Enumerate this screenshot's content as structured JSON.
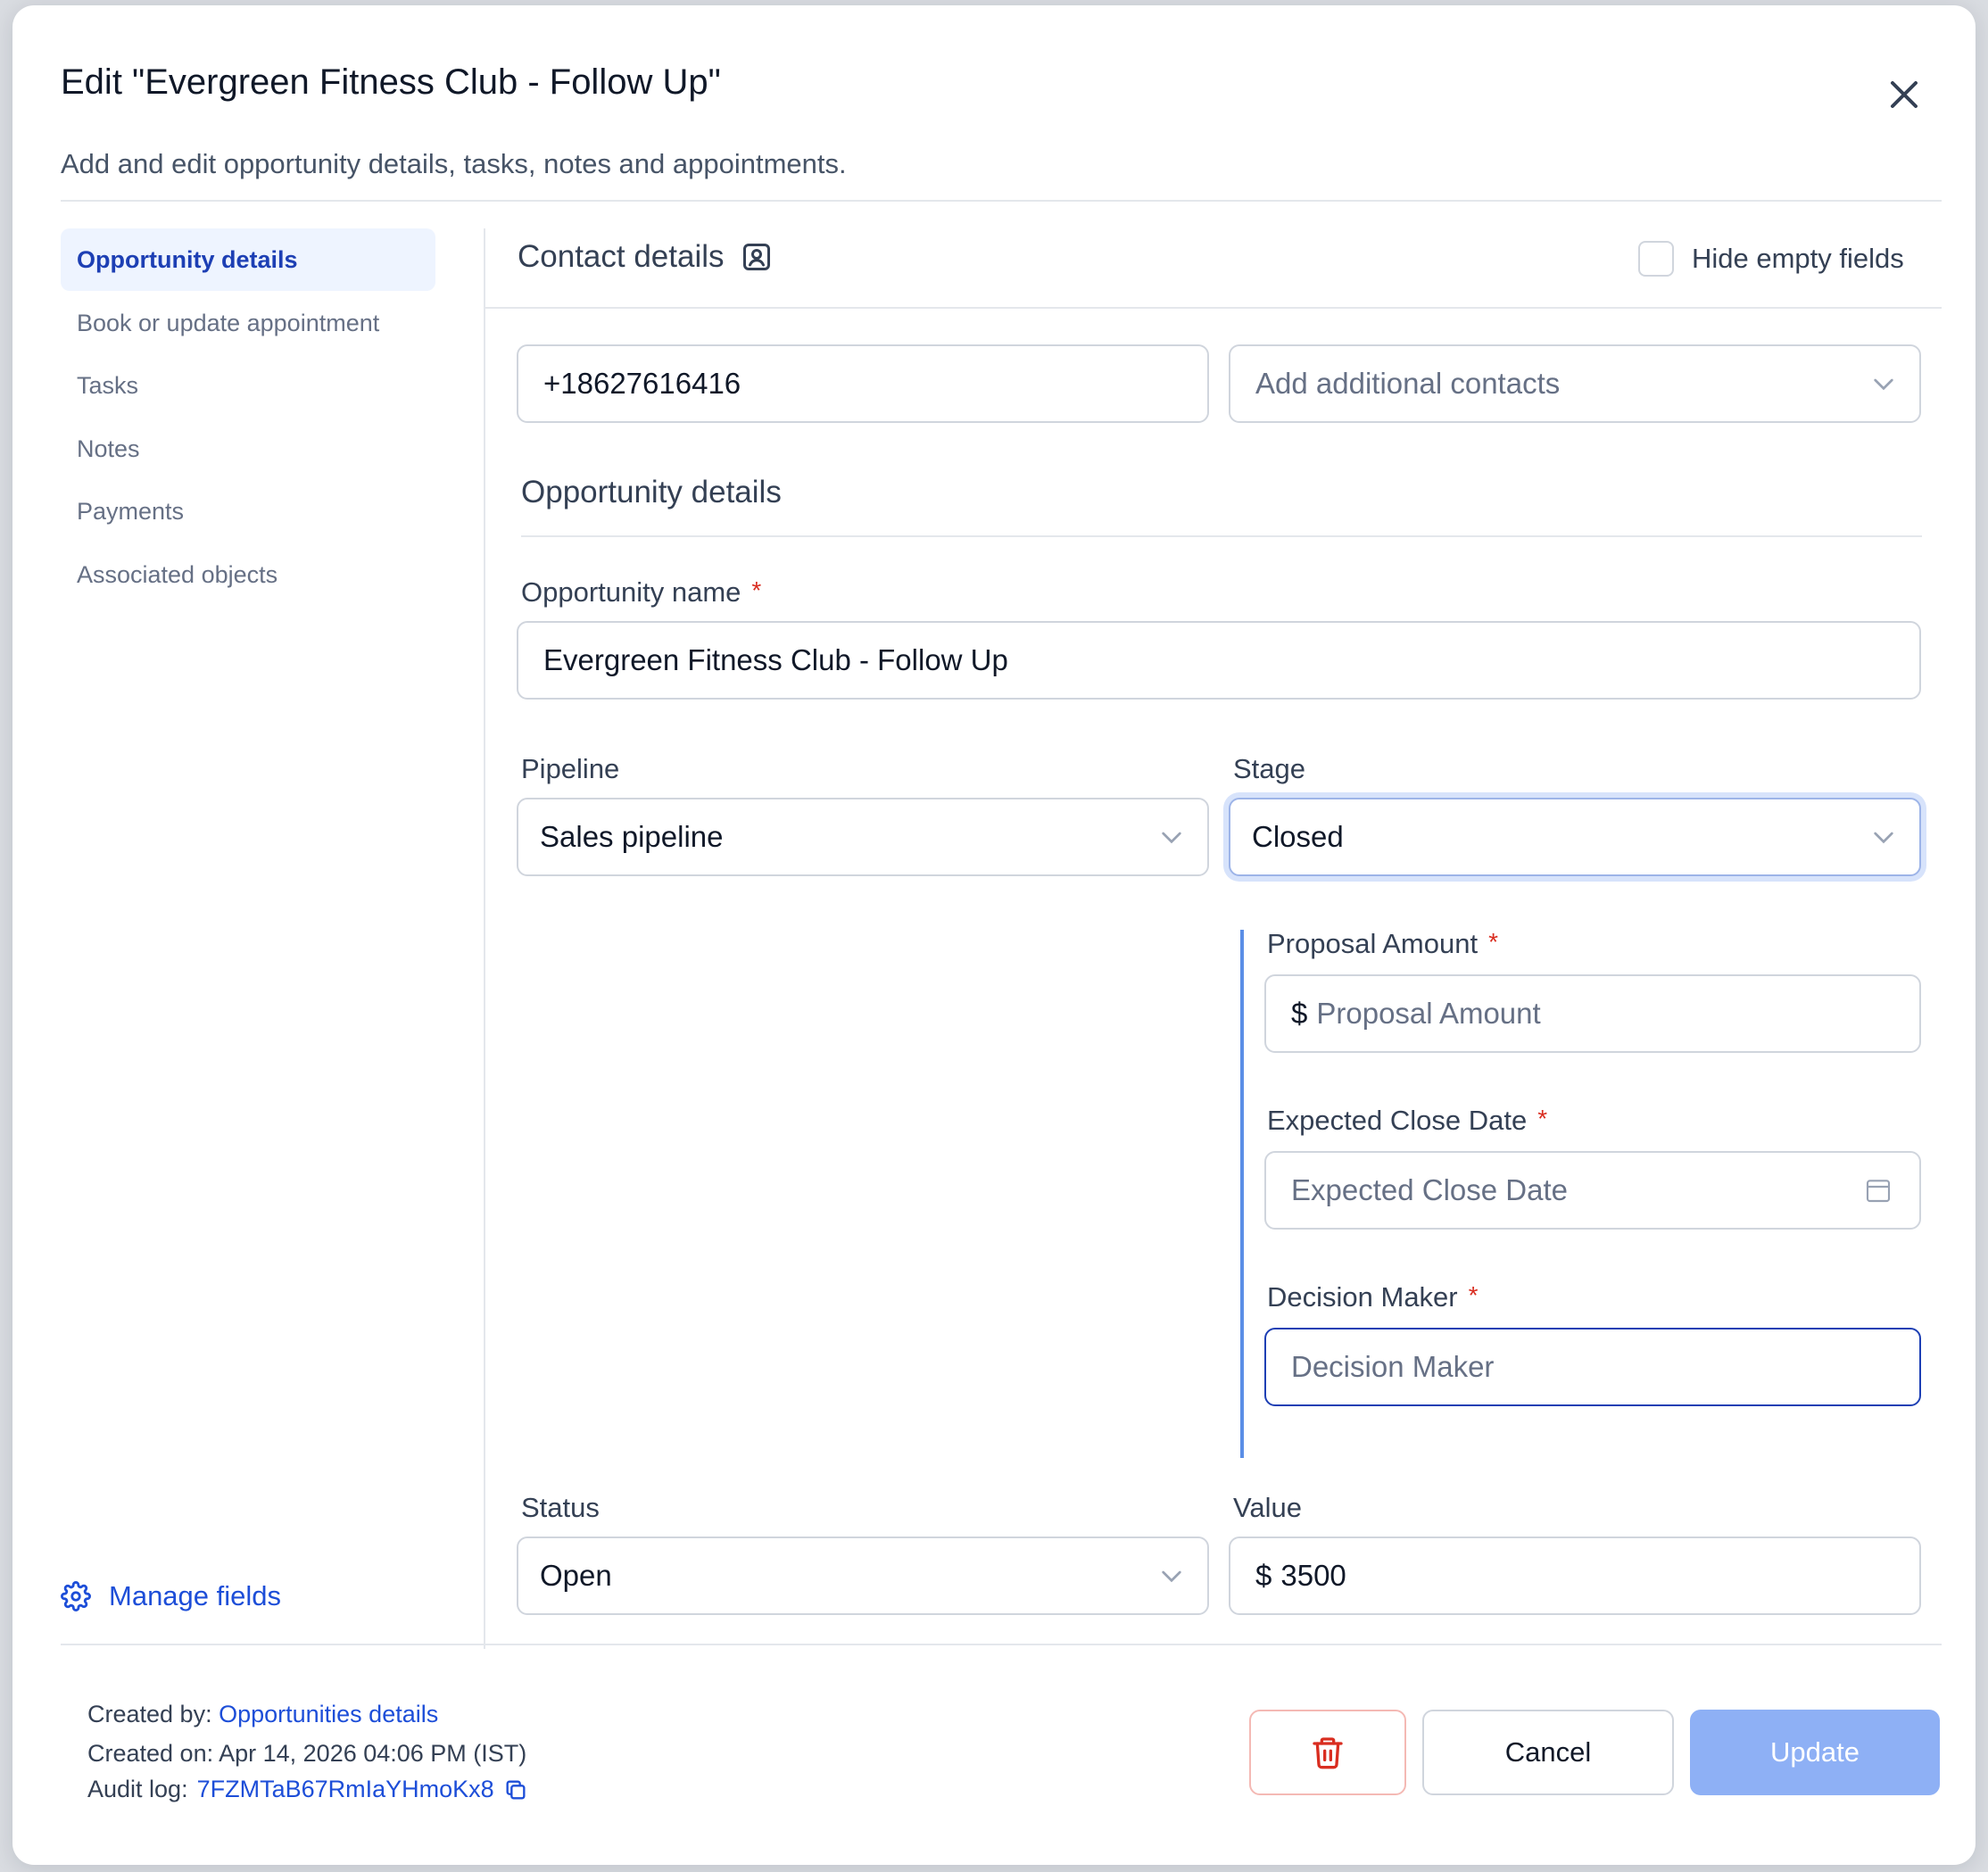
{
  "header": {
    "title": "Edit \"Evergreen Fitness Club - Follow Up\"",
    "subtitle": "Add and edit opportunity details, tasks, notes and appointments."
  },
  "sidebar": {
    "items": [
      {
        "label": "Opportunity details",
        "active": true
      },
      {
        "label": "Book or update appointment",
        "active": false
      },
      {
        "label": "Tasks",
        "active": false
      },
      {
        "label": "Notes",
        "active": false
      },
      {
        "label": "Payments",
        "active": false
      },
      {
        "label": "Associated objects",
        "active": false
      }
    ],
    "manage_fields": "Manage fields"
  },
  "contact": {
    "heading": "Contact details",
    "hide_empty_label": "Hide empty fields",
    "hide_empty_checked": false,
    "phone_value": "+18627616416",
    "additional_placeholder": "Add additional contacts"
  },
  "opportunity": {
    "heading": "Opportunity details",
    "name_label": "Opportunity name",
    "name_value": "Evergreen Fitness Club - Follow Up",
    "pipeline_label": "Pipeline",
    "pipeline_value": "Sales pipeline",
    "stage_label": "Stage",
    "stage_value": "Closed",
    "proposal_label": "Proposal Amount",
    "proposal_currency": "$",
    "proposal_placeholder": "Proposal Amount",
    "close_date_label": "Expected Close Date",
    "close_date_placeholder": "Expected Close Date",
    "decision_label": "Decision Maker",
    "decision_placeholder": "Decision Maker",
    "status_label": "Status",
    "status_value": "Open",
    "value_label": "Value",
    "value_currency": "$",
    "value_amount": "3500",
    "required_marker": "*"
  },
  "footer": {
    "created_by_label": "Created by:",
    "created_by_value": "Opportunities details",
    "created_on": "Created on: Apr 14, 2026 04:06 PM (IST)",
    "audit_label": "Audit log:",
    "audit_value": "7FZMTaB67RmIaYHmoKx8",
    "cancel_label": "Cancel",
    "update_label": "Update"
  },
  "colors": {
    "accent": "#1d4ed8",
    "required": "#d92d20",
    "update_button": "#8eb0f5",
    "delete_icon": "#d92d20"
  },
  "icons": [
    "close-icon",
    "contact-card-icon",
    "chevron-down-icon",
    "calendar-icon",
    "gear-icon",
    "trash-icon",
    "copy-icon"
  ]
}
